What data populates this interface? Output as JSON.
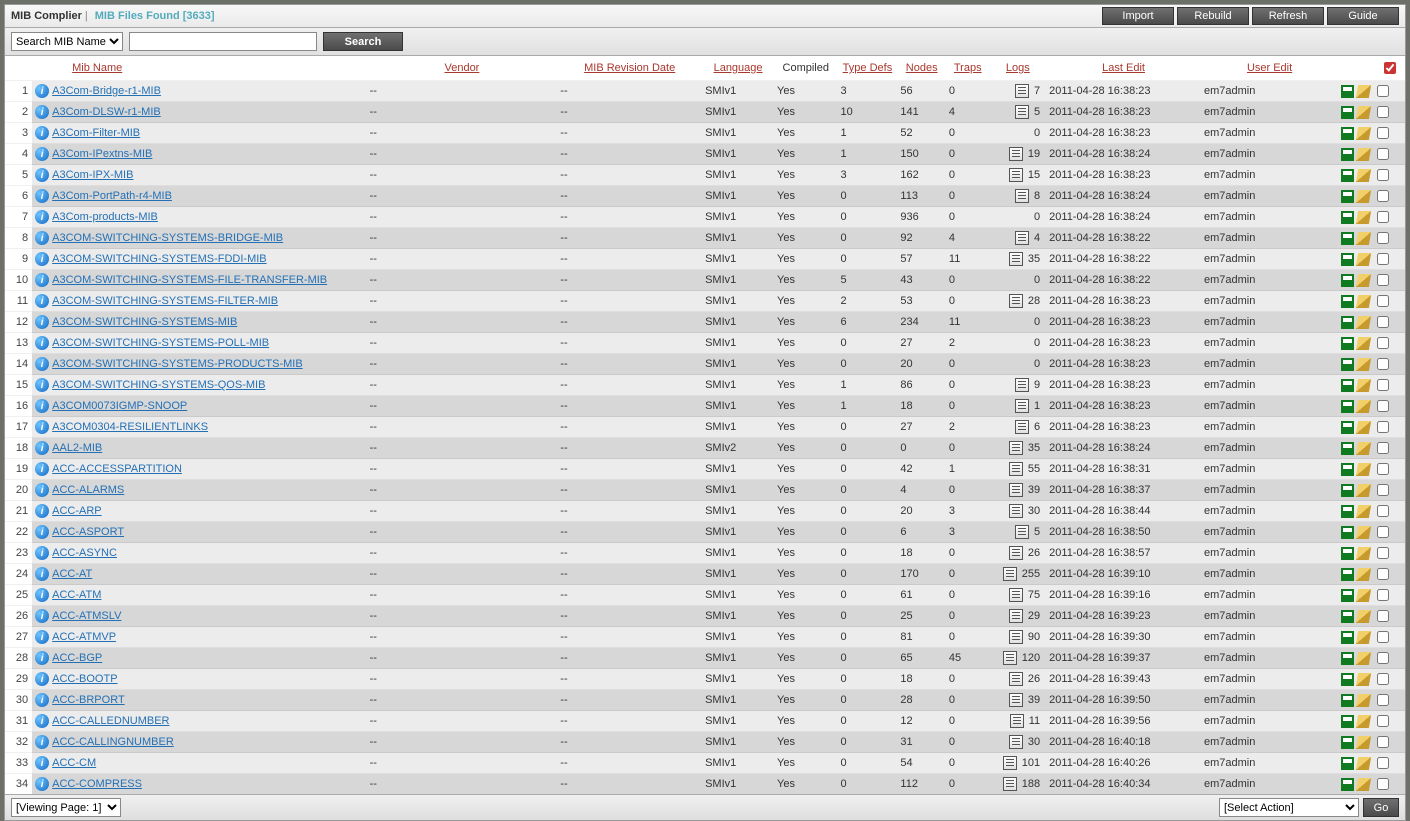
{
  "header": {
    "title": "MIB Complier",
    "subtitle": "MIB Files Found [3633]",
    "buttons": [
      "Import",
      "Rebuild",
      "Refresh",
      "Guide"
    ]
  },
  "search": {
    "field": "Search MIB Name",
    "value": "",
    "button": "Search"
  },
  "columns": [
    "Mib Name",
    "Vendor",
    "MIB Revision Date",
    "Language",
    "Compiled",
    "Type Defs",
    "Nodes",
    "Traps",
    "Logs",
    "Last Edit",
    "User Edit"
  ],
  "footer": {
    "page": "[Viewing Page: 1]",
    "action": "[Select Action]",
    "go": "Go"
  },
  "rows": [
    {
      "n": 1,
      "name": "A3Com-Bridge-r1-MIB",
      "vendor": "--",
      "date": "--",
      "lang": "SMIv1",
      "comp": "Yes",
      "td": "3",
      "nodes": "56",
      "traps": "0",
      "logs": "7",
      "last": "2011-04-28 16:38:23",
      "user": "em7admin"
    },
    {
      "n": 2,
      "name": "A3Com-DLSW-r1-MIB",
      "vendor": "--",
      "date": "--",
      "lang": "SMIv1",
      "comp": "Yes",
      "td": "10",
      "nodes": "141",
      "traps": "4",
      "logs": "5",
      "last": "2011-04-28 16:38:23",
      "user": "em7admin"
    },
    {
      "n": 3,
      "name": "A3Com-Filter-MIB",
      "vendor": "--",
      "date": "--",
      "lang": "SMIv1",
      "comp": "Yes",
      "td": "1",
      "nodes": "52",
      "traps": "0",
      "logs": "0",
      "last": "2011-04-28 16:38:23",
      "user": "em7admin"
    },
    {
      "n": 4,
      "name": "A3Com-IPextns-MIB",
      "vendor": "--",
      "date": "--",
      "lang": "SMIv1",
      "comp": "Yes",
      "td": "1",
      "nodes": "150",
      "traps": "0",
      "logs": "19",
      "last": "2011-04-28 16:38:24",
      "user": "em7admin"
    },
    {
      "n": 5,
      "name": "A3Com-IPX-MIB",
      "vendor": "--",
      "date": "--",
      "lang": "SMIv1",
      "comp": "Yes",
      "td": "3",
      "nodes": "162",
      "traps": "0",
      "logs": "15",
      "last": "2011-04-28 16:38:23",
      "user": "em7admin"
    },
    {
      "n": 6,
      "name": "A3Com-PortPath-r4-MIB",
      "vendor": "--",
      "date": "--",
      "lang": "SMIv1",
      "comp": "Yes",
      "td": "0",
      "nodes": "113",
      "traps": "0",
      "logs": "8",
      "last": "2011-04-28 16:38:24",
      "user": "em7admin"
    },
    {
      "n": 7,
      "name": "A3Com-products-MIB",
      "vendor": "--",
      "date": "--",
      "lang": "SMIv1",
      "comp": "Yes",
      "td": "0",
      "nodes": "936",
      "traps": "0",
      "logs": "0",
      "last": "2011-04-28 16:38:24",
      "user": "em7admin"
    },
    {
      "n": 8,
      "name": "A3COM-SWITCHING-SYSTEMS-BRIDGE-MIB",
      "vendor": "--",
      "date": "--",
      "lang": "SMIv1",
      "comp": "Yes",
      "td": "0",
      "nodes": "92",
      "traps": "4",
      "logs": "4",
      "last": "2011-04-28 16:38:22",
      "user": "em7admin"
    },
    {
      "n": 9,
      "name": "A3COM-SWITCHING-SYSTEMS-FDDI-MIB",
      "vendor": "--",
      "date": "--",
      "lang": "SMIv1",
      "comp": "Yes",
      "td": "0",
      "nodes": "57",
      "traps": "11",
      "logs": "35",
      "last": "2011-04-28 16:38:22",
      "user": "em7admin"
    },
    {
      "n": 10,
      "name": "A3COM-SWITCHING-SYSTEMS-FILE-TRANSFER-MIB",
      "vendor": "--",
      "date": "--",
      "lang": "SMIv1",
      "comp": "Yes",
      "td": "5",
      "nodes": "43",
      "traps": "0",
      "logs": "0",
      "last": "2011-04-28 16:38:22",
      "user": "em7admin"
    },
    {
      "n": 11,
      "name": "A3COM-SWITCHING-SYSTEMS-FILTER-MIB",
      "vendor": "--",
      "date": "--",
      "lang": "SMIv1",
      "comp": "Yes",
      "td": "2",
      "nodes": "53",
      "traps": "0",
      "logs": "28",
      "last": "2011-04-28 16:38:23",
      "user": "em7admin"
    },
    {
      "n": 12,
      "name": "A3COM-SWITCHING-SYSTEMS-MIB",
      "vendor": "--",
      "date": "--",
      "lang": "SMIv1",
      "comp": "Yes",
      "td": "6",
      "nodes": "234",
      "traps": "11",
      "logs": "0",
      "last": "2011-04-28 16:38:23",
      "user": "em7admin"
    },
    {
      "n": 13,
      "name": "A3COM-SWITCHING-SYSTEMS-POLL-MIB",
      "vendor": "--",
      "date": "--",
      "lang": "SMIv1",
      "comp": "Yes",
      "td": "0",
      "nodes": "27",
      "traps": "2",
      "logs": "0",
      "last": "2011-04-28 16:38:23",
      "user": "em7admin"
    },
    {
      "n": 14,
      "name": "A3COM-SWITCHING-SYSTEMS-PRODUCTS-MIB",
      "vendor": "--",
      "date": "--",
      "lang": "SMIv1",
      "comp": "Yes",
      "td": "0",
      "nodes": "20",
      "traps": "0",
      "logs": "0",
      "last": "2011-04-28 16:38:23",
      "user": "em7admin"
    },
    {
      "n": 15,
      "name": "A3COM-SWITCHING-SYSTEMS-QOS-MIB",
      "vendor": "--",
      "date": "--",
      "lang": "SMIv1",
      "comp": "Yes",
      "td": "1",
      "nodes": "86",
      "traps": "0",
      "logs": "9",
      "last": "2011-04-28 16:38:23",
      "user": "em7admin"
    },
    {
      "n": 16,
      "name": "A3COM0073IGMP-SNOOP",
      "vendor": "--",
      "date": "--",
      "lang": "SMIv1",
      "comp": "Yes",
      "td": "1",
      "nodes": "18",
      "traps": "0",
      "logs": "1",
      "last": "2011-04-28 16:38:23",
      "user": "em7admin"
    },
    {
      "n": 17,
      "name": "A3COM0304-RESILIENTLINKS",
      "vendor": "--",
      "date": "--",
      "lang": "SMIv1",
      "comp": "Yes",
      "td": "0",
      "nodes": "27",
      "traps": "2",
      "logs": "6",
      "last": "2011-04-28 16:38:23",
      "user": "em7admin"
    },
    {
      "n": 18,
      "name": "AAL2-MIB",
      "vendor": "--",
      "date": "--",
      "lang": "SMIv2",
      "comp": "Yes",
      "td": "0",
      "nodes": "0",
      "traps": "0",
      "logs": "35",
      "last": "2011-04-28 16:38:24",
      "user": "em7admin"
    },
    {
      "n": 19,
      "name": "ACC-ACCESSPARTITION",
      "vendor": "--",
      "date": "--",
      "lang": "SMIv1",
      "comp": "Yes",
      "td": "0",
      "nodes": "42",
      "traps": "1",
      "logs": "55",
      "last": "2011-04-28 16:38:31",
      "user": "em7admin"
    },
    {
      "n": 20,
      "name": "ACC-ALARMS",
      "vendor": "--",
      "date": "--",
      "lang": "SMIv1",
      "comp": "Yes",
      "td": "0",
      "nodes": "4",
      "traps": "0",
      "logs": "39",
      "last": "2011-04-28 16:38:37",
      "user": "em7admin"
    },
    {
      "n": 21,
      "name": "ACC-ARP",
      "vendor": "--",
      "date": "--",
      "lang": "SMIv1",
      "comp": "Yes",
      "td": "0",
      "nodes": "20",
      "traps": "3",
      "logs": "30",
      "last": "2011-04-28 16:38:44",
      "user": "em7admin"
    },
    {
      "n": 22,
      "name": "ACC-ASPORT",
      "vendor": "--",
      "date": "--",
      "lang": "SMIv1",
      "comp": "Yes",
      "td": "0",
      "nodes": "6",
      "traps": "3",
      "logs": "5",
      "last": "2011-04-28 16:38:50",
      "user": "em7admin"
    },
    {
      "n": 23,
      "name": "ACC-ASYNC",
      "vendor": "--",
      "date": "--",
      "lang": "SMIv1",
      "comp": "Yes",
      "td": "0",
      "nodes": "18",
      "traps": "0",
      "logs": "26",
      "last": "2011-04-28 16:38:57",
      "user": "em7admin"
    },
    {
      "n": 24,
      "name": "ACC-AT",
      "vendor": "--",
      "date": "--",
      "lang": "SMIv1",
      "comp": "Yes",
      "td": "0",
      "nodes": "170",
      "traps": "0",
      "logs": "255",
      "last": "2011-04-28 16:39:10",
      "user": "em7admin"
    },
    {
      "n": 25,
      "name": "ACC-ATM",
      "vendor": "--",
      "date": "--",
      "lang": "SMIv1",
      "comp": "Yes",
      "td": "0",
      "nodes": "61",
      "traps": "0",
      "logs": "75",
      "last": "2011-04-28 16:39:16",
      "user": "em7admin"
    },
    {
      "n": 26,
      "name": "ACC-ATMSLV",
      "vendor": "--",
      "date": "--",
      "lang": "SMIv1",
      "comp": "Yes",
      "td": "0",
      "nodes": "25",
      "traps": "0",
      "logs": "29",
      "last": "2011-04-28 16:39:23",
      "user": "em7admin"
    },
    {
      "n": 27,
      "name": "ACC-ATMVP",
      "vendor": "--",
      "date": "--",
      "lang": "SMIv1",
      "comp": "Yes",
      "td": "0",
      "nodes": "81",
      "traps": "0",
      "logs": "90",
      "last": "2011-04-28 16:39:30",
      "user": "em7admin"
    },
    {
      "n": 28,
      "name": "ACC-BGP",
      "vendor": "--",
      "date": "--",
      "lang": "SMIv1",
      "comp": "Yes",
      "td": "0",
      "nodes": "65",
      "traps": "45",
      "logs": "120",
      "last": "2011-04-28 16:39:37",
      "user": "em7admin"
    },
    {
      "n": 29,
      "name": "ACC-BOOTP",
      "vendor": "--",
      "date": "--",
      "lang": "SMIv1",
      "comp": "Yes",
      "td": "0",
      "nodes": "18",
      "traps": "0",
      "logs": "26",
      "last": "2011-04-28 16:39:43",
      "user": "em7admin"
    },
    {
      "n": 30,
      "name": "ACC-BRPORT",
      "vendor": "--",
      "date": "--",
      "lang": "SMIv1",
      "comp": "Yes",
      "td": "0",
      "nodes": "28",
      "traps": "0",
      "logs": "39",
      "last": "2011-04-28 16:39:50",
      "user": "em7admin"
    },
    {
      "n": 31,
      "name": "ACC-CALLEDNUMBER",
      "vendor": "--",
      "date": "--",
      "lang": "SMIv1",
      "comp": "Yes",
      "td": "0",
      "nodes": "12",
      "traps": "0",
      "logs": "11",
      "last": "2011-04-28 16:39:56",
      "user": "em7admin"
    },
    {
      "n": 32,
      "name": "ACC-CALLINGNUMBER",
      "vendor": "--",
      "date": "--",
      "lang": "SMIv1",
      "comp": "Yes",
      "td": "0",
      "nodes": "31",
      "traps": "0",
      "logs": "30",
      "last": "2011-04-28 16:40:18",
      "user": "em7admin"
    },
    {
      "n": 33,
      "name": "ACC-CM",
      "vendor": "--",
      "date": "--",
      "lang": "SMIv1",
      "comp": "Yes",
      "td": "0",
      "nodes": "54",
      "traps": "0",
      "logs": "101",
      "last": "2011-04-28 16:40:26",
      "user": "em7admin"
    },
    {
      "n": 34,
      "name": "ACC-COMPRESS",
      "vendor": "--",
      "date": "--",
      "lang": "SMIv1",
      "comp": "Yes",
      "td": "0",
      "nodes": "112",
      "traps": "0",
      "logs": "188",
      "last": "2011-04-28 16:40:34",
      "user": "em7admin"
    }
  ]
}
